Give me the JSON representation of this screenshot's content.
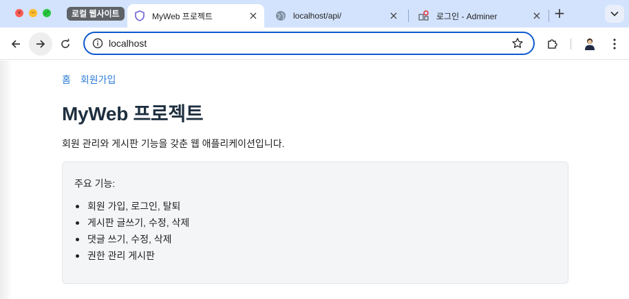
{
  "browser": {
    "tab_group": "로컬 웹사이트",
    "tabs": [
      {
        "title": "MyWeb 프로젝트",
        "icon": "shield-icon",
        "active": true
      },
      {
        "title": "localhost/api/",
        "icon": "globe-icon",
        "active": false
      },
      {
        "title": "로그인 - Adminer",
        "icon": "adminer-icon",
        "active": false
      }
    ],
    "close_glyph": "×",
    "newtab_glyph": "+",
    "address": "localhost"
  },
  "page": {
    "breadcrumbs": [
      "홈",
      "회원가입"
    ],
    "title": "MyWeb 프로젝트",
    "description": "회원 관리와 게시판 기능을 갖춘 웹 애플리케이션입니다.",
    "features_heading": "주요 기능:",
    "features": [
      "회원 가입, 로그인, 탈퇴",
      "게시판 글쓰기, 수정, 삭제",
      "댓글 쓰기, 수정, 삭제",
      "권한 관리 게시판"
    ]
  },
  "colors": {
    "tabstrip": "#d3e3fd",
    "accent": "#0b57d0",
    "link": "#2b7bd6",
    "title": "#1e2f3f"
  }
}
